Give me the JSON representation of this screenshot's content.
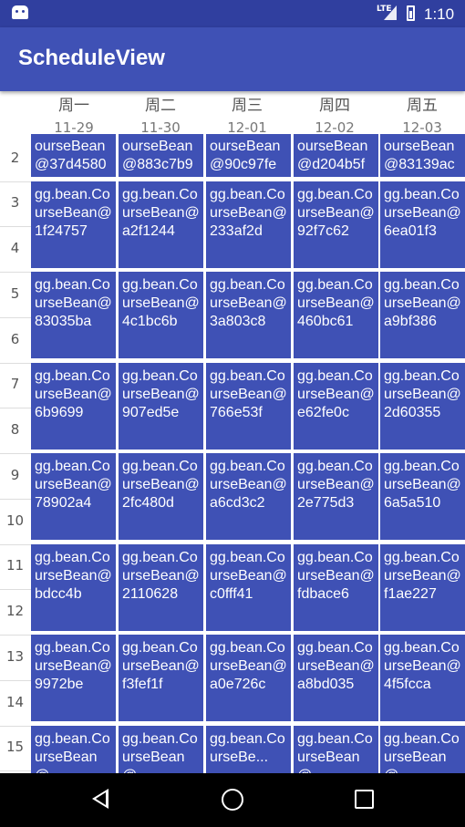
{
  "status_bar": {
    "network": "LTE",
    "time": "1:10"
  },
  "app_bar": {
    "title": "ScheduleView"
  },
  "days": [
    {
      "weekday": "周一",
      "date": "11-29"
    },
    {
      "weekday": "周二",
      "date": "11-30"
    },
    {
      "weekday": "周三",
      "date": "12-01"
    },
    {
      "weekday": "周四",
      "date": "12-02"
    },
    {
      "weekday": "周五",
      "date": "12-03"
    }
  ],
  "row_numbers": [
    "2",
    "3",
    "4",
    "5",
    "6",
    "7",
    "8",
    "9",
    "10",
    "11",
    "12",
    "13",
    "14",
    "15"
  ],
  "courses": [
    [
      "ourseBean@37d4580",
      "ourseBean@883c7b9",
      "ourseBean@90c97fe",
      "ourseBean@d204b5f",
      "ourseBean@83139ac"
    ],
    [
      "gg.bean.CourseBean@1f24757",
      "gg.bean.CourseBean@a2f1244",
      "gg.bean.CourseBean@233af2d",
      "gg.bean.CourseBean@92f7c62",
      "gg.bean.CourseBean@6ea01f3"
    ],
    [
      "gg.bean.CourseBean@83035ba",
      "gg.bean.CourseBean@4c1bc6b",
      "gg.bean.CourseBean@3a803c8",
      "gg.bean.CourseBean@460bc61",
      "gg.bean.CourseBean@a9bf386"
    ],
    [
      "gg.bean.CourseBean@6b9699",
      "gg.bean.CourseBean@907ed5e",
      "gg.bean.CourseBean@766e53f",
      "gg.bean.CourseBean@e62fe0c",
      "gg.bean.CourseBean@2d60355"
    ],
    [
      "gg.bean.CourseBean@78902a4",
      "gg.bean.CourseBean@2fc480d",
      "gg.bean.CourseBean@a6cd3c2",
      "gg.bean.CourseBean@2e775d3",
      "gg.bean.CourseBean@6a5a510"
    ],
    [
      "gg.bean.CourseBean@bdcc4b",
      "gg.bean.CourseBean@2110628",
      "gg.bean.CourseBean@c0fff41",
      "gg.bean.CourseBean@fdbace6",
      "gg.bean.CourseBean@f1ae227"
    ],
    [
      "gg.bean.CourseBean@9972be",
      "gg.bean.CourseBean@f3fef1f",
      "gg.bean.CourseBean@a0e726c",
      "gg.bean.CourseBean@a8bd035",
      "gg.bean.CourseBean@4f5fcca"
    ],
    [
      "gg.bean.CourseBean@...",
      "gg.bean.CourseBean@...",
      "gg.bean.CourseBe...",
      "gg.bean.CourseBean@...",
      "gg.bean.CourseBean@..."
    ]
  ]
}
